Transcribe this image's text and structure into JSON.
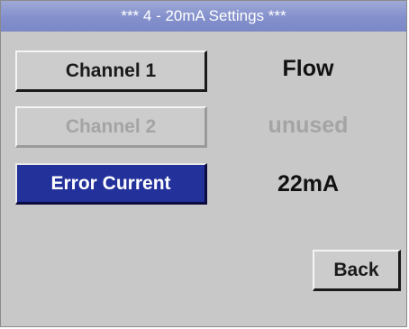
{
  "title": "*** 4 - 20mA Settings ***",
  "rows": [
    {
      "button_label": "Channel 1",
      "value": "Flow",
      "state": "normal"
    },
    {
      "button_label": "Channel 2",
      "value": "unused",
      "state": "disabled"
    },
    {
      "button_label": "Error Current",
      "value": "22mA",
      "state": "selected"
    }
  ],
  "back_label": "Back",
  "colors": {
    "background": "#c8c8c8",
    "title_bar": "#8390cc",
    "selected": "#23319b",
    "disabled_text": "#a4a4a4"
  }
}
